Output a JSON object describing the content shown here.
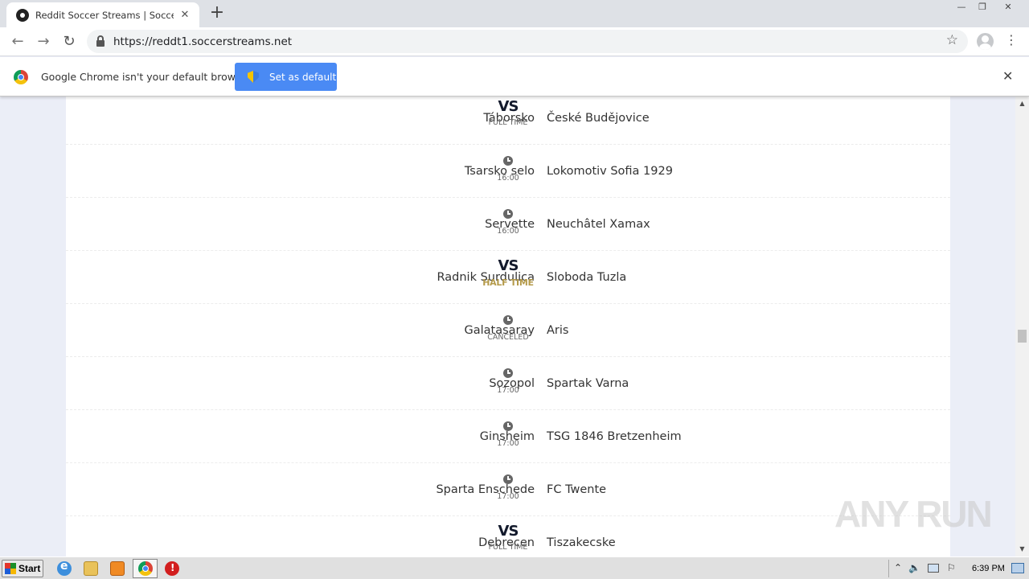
{
  "browser": {
    "tab_title": "Reddit Soccer Streams | Soccer Stre",
    "tab_close": "✕",
    "new_tab": "+",
    "url": "https://reddt1.soccerstreams.net",
    "back": "←",
    "forward": "→",
    "reload": "↻",
    "star": "☆",
    "menu": "⋮",
    "win_minimize": "—",
    "win_restore": "❐",
    "win_close": "✕"
  },
  "infobar": {
    "message": "Google Chrome isn't your default browser",
    "button_label": "Set as default",
    "close": "✕"
  },
  "matches": [
    {
      "home": "Táborsko",
      "away": "České Budějovice",
      "vs": "VS",
      "status": "FULL TIME",
      "kind": "vs"
    },
    {
      "home": "Tsarsko selo",
      "away": "Lokomotiv Sofia 1929",
      "status": "16:00",
      "kind": "time"
    },
    {
      "home": "Servette",
      "away": "Neuchâtel Xamax",
      "status": "16:00",
      "kind": "time"
    },
    {
      "home": "Radnik Surdulica",
      "away": "Sloboda Tuzla",
      "vs": "VS",
      "status": "HALF TIME",
      "kind": "half"
    },
    {
      "home": "Galatasaray",
      "away": "Aris",
      "status": "CANCELED",
      "kind": "time"
    },
    {
      "home": "Sozopol",
      "away": "Spartak Varna",
      "status": "17:00",
      "kind": "time"
    },
    {
      "home": "Ginsheim",
      "away": "TSG 1846 Bretzenheim",
      "status": "17:00",
      "kind": "time"
    },
    {
      "home": "Sparta Enschede",
      "away": "FC Twente",
      "status": "17:00",
      "kind": "time"
    },
    {
      "home": "Debrecen",
      "away": "Tiszakecske",
      "vs": "VS",
      "status": "FULL TIME",
      "kind": "vs"
    }
  ],
  "scrollbar": {
    "up": "▲",
    "down": "▼"
  },
  "watermark": "ANY RUN",
  "taskbar": {
    "start_label": "Start",
    "clock": "6:39 PM",
    "tray_up": "⌃",
    "tray_sound": "🔈",
    "tray_flag": "⚐"
  },
  "colors": {
    "accent": "#4a8af4",
    "half_time": "#b49a4a",
    "vs": "#131a2c",
    "page_bg": "#ebeef7"
  }
}
